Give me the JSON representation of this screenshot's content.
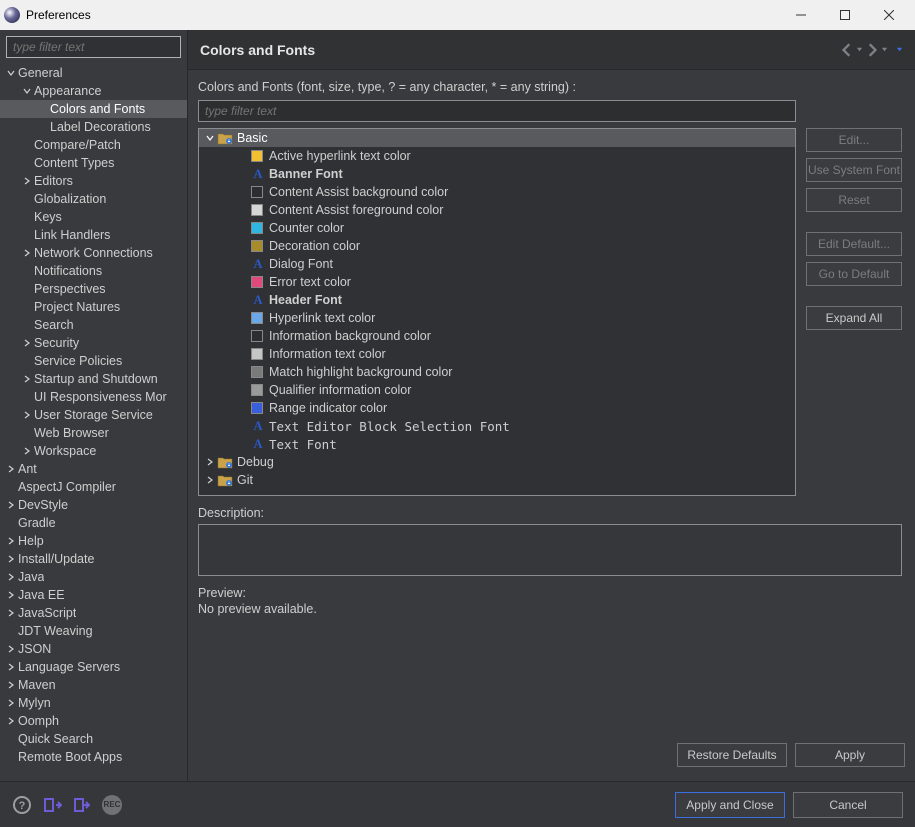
{
  "titlebar": {
    "title": "Preferences"
  },
  "left": {
    "filter_placeholder": "type filter text",
    "tree": [
      {
        "label": "General",
        "depth": 0,
        "expanded": true
      },
      {
        "label": "Appearance",
        "depth": 1,
        "expanded": true
      },
      {
        "label": "Colors and Fonts",
        "depth": 2,
        "selected": true
      },
      {
        "label": "Label Decorations",
        "depth": 2
      },
      {
        "label": "Compare/Patch",
        "depth": 1
      },
      {
        "label": "Content Types",
        "depth": 1
      },
      {
        "label": "Editors",
        "depth": 1,
        "expandable": true
      },
      {
        "label": "Globalization",
        "depth": 1
      },
      {
        "label": "Keys",
        "depth": 1
      },
      {
        "label": "Link Handlers",
        "depth": 1
      },
      {
        "label": "Network Connections",
        "depth": 1,
        "expandable": true
      },
      {
        "label": "Notifications",
        "depth": 1
      },
      {
        "label": "Perspectives",
        "depth": 1
      },
      {
        "label": "Project Natures",
        "depth": 1
      },
      {
        "label": "Search",
        "depth": 1
      },
      {
        "label": "Security",
        "depth": 1,
        "expandable": true
      },
      {
        "label": "Service Policies",
        "depth": 1
      },
      {
        "label": "Startup and Shutdown",
        "depth": 1,
        "expandable": true
      },
      {
        "label": "UI Responsiveness Mor",
        "depth": 1
      },
      {
        "label": "User Storage Service",
        "depth": 1,
        "expandable": true
      },
      {
        "label": "Web Browser",
        "depth": 1
      },
      {
        "label": "Workspace",
        "depth": 1,
        "expandable": true
      },
      {
        "label": "Ant",
        "depth": 0,
        "expandable": true
      },
      {
        "label": "AspectJ Compiler",
        "depth": 0
      },
      {
        "label": "DevStyle",
        "depth": 0,
        "expandable": true
      },
      {
        "label": "Gradle",
        "depth": 0
      },
      {
        "label": "Help",
        "depth": 0,
        "expandable": true
      },
      {
        "label": "Install/Update",
        "depth": 0,
        "expandable": true
      },
      {
        "label": "Java",
        "depth": 0,
        "expandable": true
      },
      {
        "label": "Java EE",
        "depth": 0,
        "expandable": true
      },
      {
        "label": "JavaScript",
        "depth": 0,
        "expandable": true
      },
      {
        "label": "JDT Weaving",
        "depth": 0
      },
      {
        "label": "JSON",
        "depth": 0,
        "expandable": true
      },
      {
        "label": "Language Servers",
        "depth": 0,
        "expandable": true
      },
      {
        "label": "Maven",
        "depth": 0,
        "expandable": true
      },
      {
        "label": "Mylyn",
        "depth": 0,
        "expandable": true
      },
      {
        "label": "Oomph",
        "depth": 0,
        "expandable": true
      },
      {
        "label": "Quick Search",
        "depth": 0
      },
      {
        "label": "Remote Boot Apps",
        "depth": 0
      }
    ]
  },
  "right": {
    "title": "Colors and Fonts",
    "subtitle": "Colors and Fonts (font, size, type, ? = any character, * = any string) :",
    "filter_placeholder": "type filter text",
    "tree": [
      {
        "kind": "folder",
        "label": "Basic",
        "depth": 0,
        "expanded": true,
        "selected": true
      },
      {
        "kind": "color",
        "label": "Active hyperlink text color",
        "swatch": "#f2c033",
        "depth": 1
      },
      {
        "kind": "font",
        "label": "Banner Font",
        "bold": true,
        "depth": 1
      },
      {
        "kind": "color",
        "label": "Content Assist background color",
        "swatch": "#2b2d30",
        "depth": 1
      },
      {
        "kind": "color",
        "label": "Content Assist foreground color",
        "swatch": "#d6d6d6",
        "depth": 1
      },
      {
        "kind": "color",
        "label": "Counter color",
        "swatch": "#2fb6e0",
        "depth": 1
      },
      {
        "kind": "color",
        "label": "Decoration color",
        "swatch": "#a88b2a",
        "depth": 1
      },
      {
        "kind": "font",
        "label": "Dialog Font",
        "depth": 1
      },
      {
        "kind": "color",
        "label": "Error text color",
        "swatch": "#e04a7a",
        "depth": 1
      },
      {
        "kind": "font",
        "label": "Header Font",
        "bold": true,
        "depth": 1
      },
      {
        "kind": "color",
        "label": "Hyperlink text color",
        "swatch": "#6aa8e8",
        "depth": 1
      },
      {
        "kind": "color",
        "label": "Information background color",
        "swatch": "#2b2d30",
        "depth": 1
      },
      {
        "kind": "color",
        "label": "Information text color",
        "swatch": "#c6c6c6",
        "depth": 1
      },
      {
        "kind": "color",
        "label": "Match highlight background color",
        "swatch": "#7a7a7a",
        "depth": 1
      },
      {
        "kind": "color",
        "label": "Qualifier information color",
        "swatch": "#9a9a9a",
        "depth": 1
      },
      {
        "kind": "color",
        "label": "Range indicator color",
        "swatch": "#3a5fdc",
        "depth": 1
      },
      {
        "kind": "font",
        "label": "Text Editor Block Selection Font",
        "mono": true,
        "depth": 1
      },
      {
        "kind": "font",
        "label": "Text Font",
        "mono": true,
        "depth": 1
      },
      {
        "kind": "folder",
        "label": "Debug",
        "depth": 0,
        "expandable": true
      },
      {
        "kind": "folder",
        "label": "Git",
        "depth": 0,
        "expandable": true
      }
    ],
    "buttons": {
      "edit": "Edit...",
      "use_system": "Use System Font",
      "reset": "Reset",
      "edit_default": "Edit Default...",
      "go_default": "Go to Default",
      "expand_all": "Expand All"
    },
    "description_label": "Description:",
    "preview_label": "Preview:",
    "preview_text": "No preview available.",
    "restore_defaults": "Restore Defaults",
    "apply": "Apply"
  },
  "footer": {
    "apply_close": "Apply and Close",
    "cancel": "Cancel",
    "rec": "REC"
  }
}
